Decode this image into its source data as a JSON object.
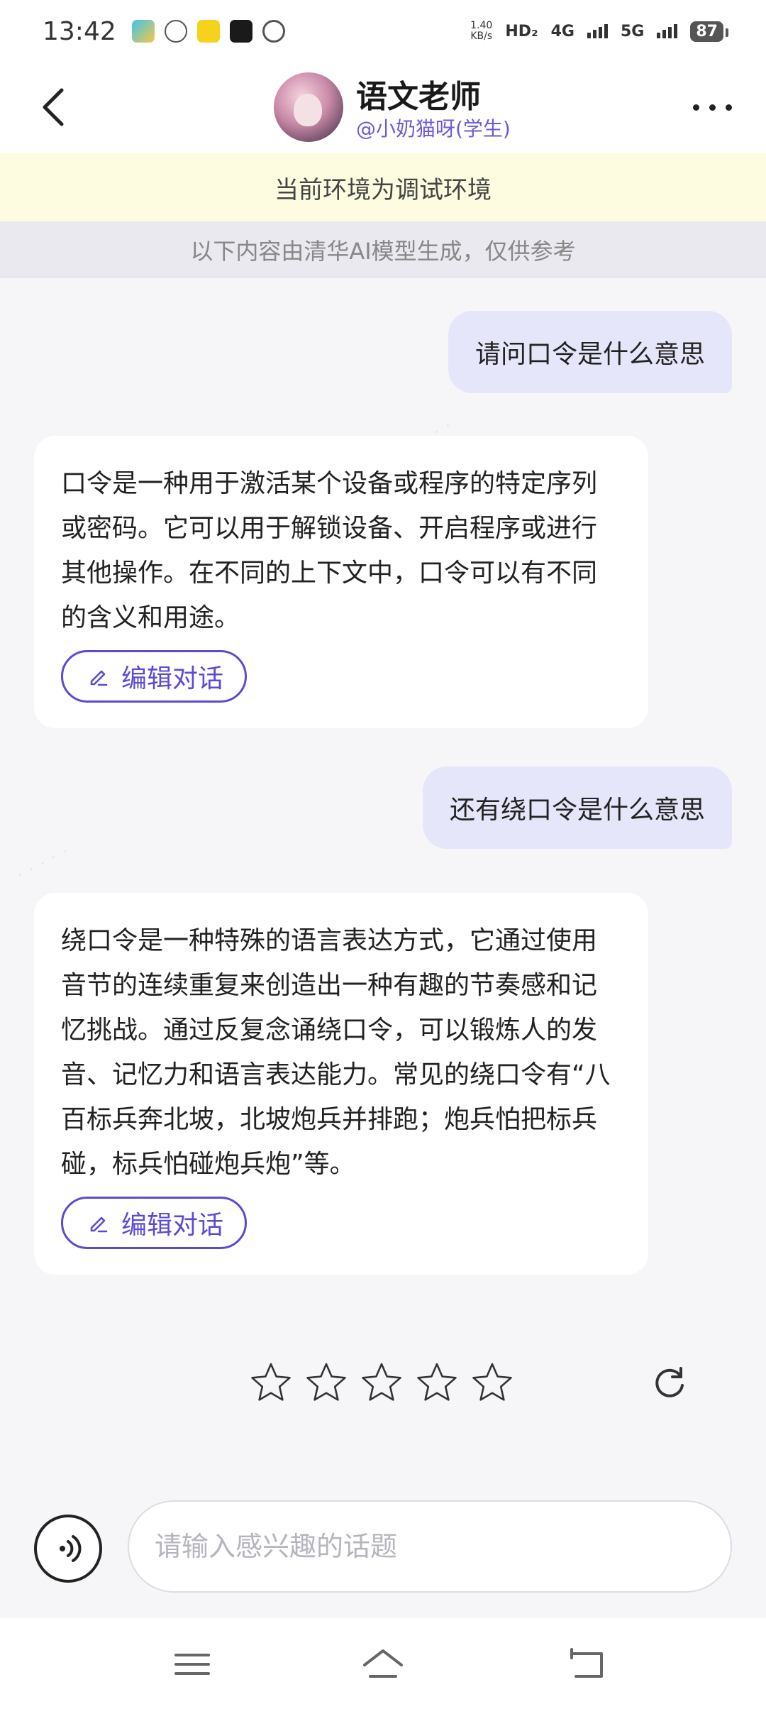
{
  "status_bar": {
    "time": "13:42",
    "net_speed_value": "1.40",
    "net_speed_unit": "KB/s",
    "hd_label": "HD₂",
    "network_1": "4G",
    "network_2": "5G",
    "battery": "87",
    "notification_icons": [
      "gallery-app-icon",
      "wechat-icon",
      "kuaishou-icon",
      "tiktok-icon",
      "browser-icon"
    ]
  },
  "header": {
    "title": "语文老师",
    "subtitle": "@小奶猫呀(学生)"
  },
  "env_banner": "当前环境为调试环境",
  "ai_notice": "以下内容由清华AI模型生成，仅供参考",
  "messages": [
    {
      "role": "user",
      "text": "请问口令是什么意思"
    },
    {
      "role": "bot",
      "text": "口令是一种用于激活某个设备或程序的特定序列或密码。它可以用于解锁设备、开启程序或进行其他操作。在不同的上下文中，口令可以有不同的含义和用途。",
      "edit_label": "编辑对话"
    },
    {
      "role": "user",
      "text": "还有绕口令是什么意思"
    },
    {
      "role": "bot",
      "text": "绕口令是一种特殊的语言表达方式，它通过使用音节的连续重复来创造出一种有趣的节奏感和记忆挑战。通过反复念诵绕口令，可以锻炼人的发音、记忆力和语言表达能力。常见的绕口令有“八百标兵奔北坡，北坡炮兵并排跑；炮兵怕把标兵碰，标兵怕碰炮兵炮”等。",
      "edit_label": "编辑对话"
    }
  ],
  "rating": {
    "stars_total": 5,
    "stars_selected": 0
  },
  "input": {
    "placeholder": "请输入感兴趣的话题",
    "value": ""
  },
  "colors": {
    "accent": "#5a4ad6",
    "user_bubble": "#e6e6fb",
    "banner": "#fdfbe0"
  }
}
